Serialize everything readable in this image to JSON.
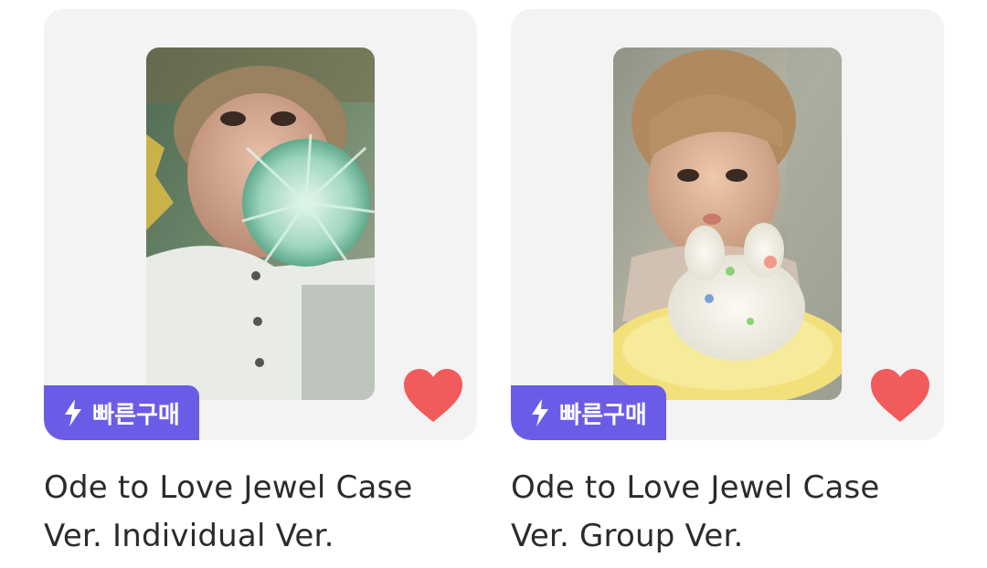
{
  "products": [
    {
      "badge_label": "빠른구매",
      "badge_icon": "lightning-bolt-icon",
      "favorite_icon": "heart-icon",
      "favorited": true,
      "title_line1": "Ode to Love Jewel Case",
      "title_line2": "Ver. Individual Ver."
    },
    {
      "badge_label": "빠른구매",
      "badge_icon": "lightning-bolt-icon",
      "favorite_icon": "heart-icon",
      "favorited": true,
      "title_line1": "Ode to Love Jewel Case",
      "title_line2": "Ver. Group Ver."
    }
  ],
  "colors": {
    "card_bg": "#f3f3f3",
    "badge_bg": "#6b5ce7",
    "heart": "#f25b5b",
    "title_text": "#2b2b2b"
  }
}
